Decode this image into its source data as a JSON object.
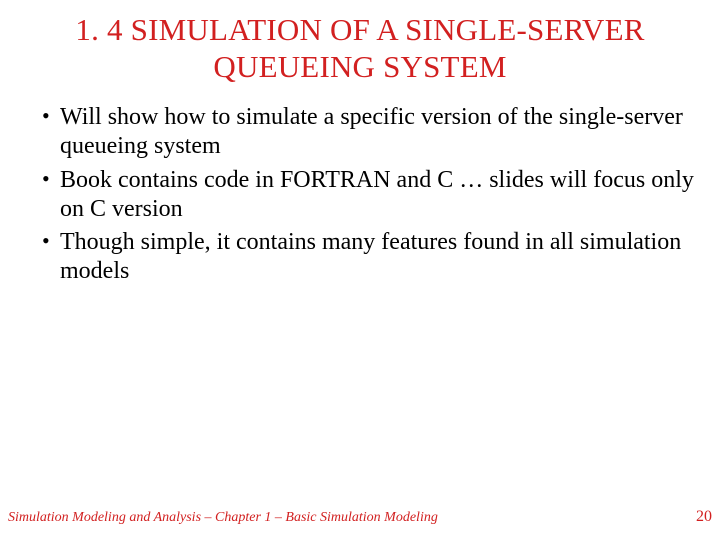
{
  "title_line1": "1. 4  SIMULATION OF A SINGLE-SERVER",
  "title_line2": "QUEUEING SYSTEM",
  "bullets": [
    "Will show how to simulate a specific version of the single-server queueing system",
    "Book contains code in FORTRAN and C … slides will focus only on C version",
    "Though simple, it contains many features found in all simulation models"
  ],
  "footer_left": "Simulation Modeling and Analysis – Chapter 1 –  Basic Simulation Modeling",
  "footer_right": "20"
}
